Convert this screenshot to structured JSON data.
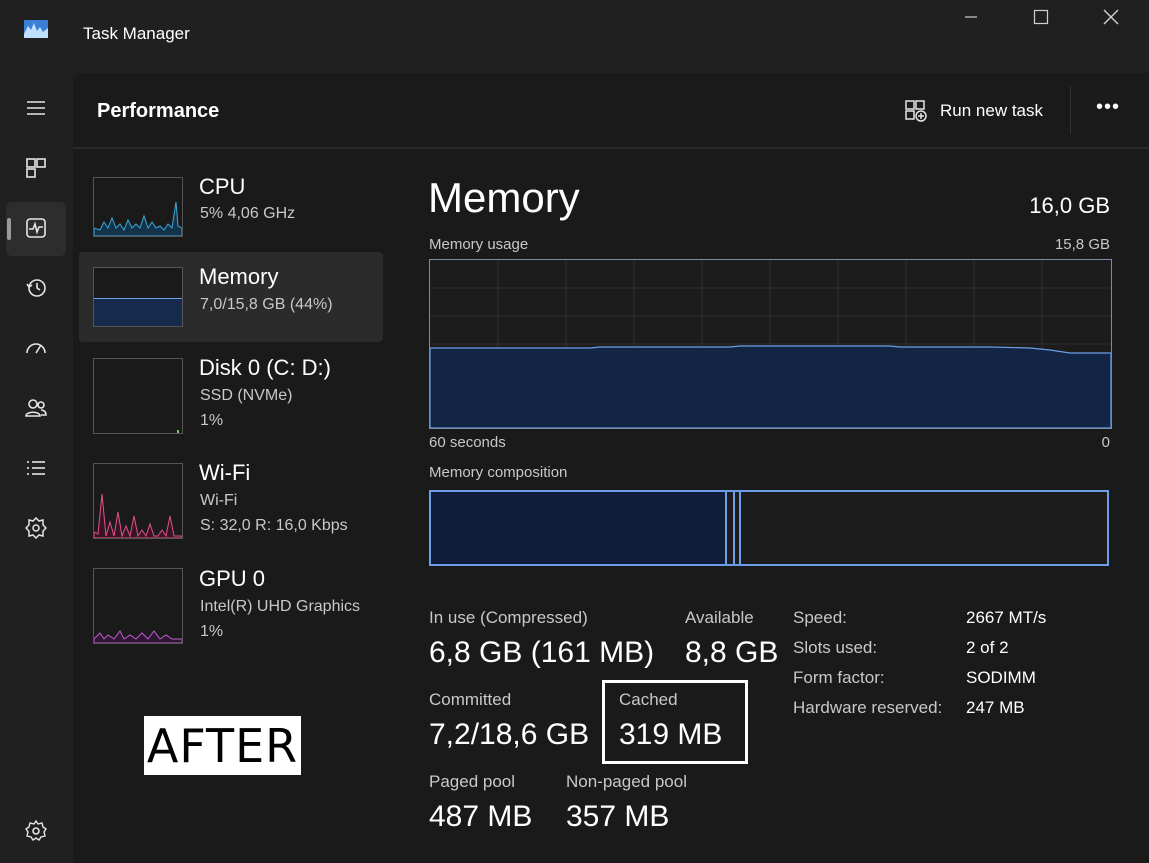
{
  "window": {
    "title": "Task Manager",
    "controls": [
      "minimize",
      "maximize",
      "close"
    ]
  },
  "nav": {
    "items": [
      {
        "icon": "hamburger-icon"
      },
      {
        "icon": "processes-icon"
      },
      {
        "icon": "performance-icon",
        "active": true
      },
      {
        "icon": "app-history-icon"
      },
      {
        "icon": "startup-apps-icon"
      },
      {
        "icon": "users-icon"
      },
      {
        "icon": "details-icon"
      },
      {
        "icon": "services-icon"
      },
      {
        "icon": "settings-icon"
      }
    ]
  },
  "header": {
    "title": "Performance",
    "run_new_task": "Run new task",
    "more": "•••"
  },
  "sidebar": {
    "cpu": {
      "name": "CPU",
      "line1": "5%  4,06 GHz",
      "color": "#3aa9d8"
    },
    "memory": {
      "name": "Memory",
      "line1": "7,0/15,8 GB (44%)",
      "color": "#6e9ee8",
      "active": true
    },
    "disk": {
      "name": "Disk 0 (C: D:)",
      "line1": "SSD (NVMe)",
      "line2": "1%",
      "color": "#7cc36a"
    },
    "wifi": {
      "name": "Wi-Fi",
      "line1": "Wi-Fi",
      "line2": "S: 32,0  R: 16,0 Kbps",
      "color": "#e0528a"
    },
    "gpu": {
      "name": "GPU 0",
      "line1": "Intel(R) UHD Graphics",
      "line2": "1%",
      "color": "#c05ccc"
    }
  },
  "memory": {
    "title": "Memory",
    "total": "16,0 GB",
    "usage_label": "Memory usage",
    "usage_max": "15,8 GB",
    "axis_left": "60 seconds",
    "axis_right": "0",
    "composition_label": "Memory composition",
    "stats": {
      "in_use_label": "In use (Compressed)",
      "in_use_value": "6,8 GB (161 MB)",
      "available_label": "Available",
      "available_value": "8,8 GB",
      "committed_label": "Committed",
      "committed_value": "7,2/18,6 GB",
      "cached_label": "Cached",
      "cached_value": "319 MB",
      "paged_label": "Paged pool",
      "paged_value": "487 MB",
      "nonpaged_label": "Non-paged pool",
      "nonpaged_value": "357 MB"
    },
    "specs": [
      {
        "label": "Speed:",
        "value": "2667 MT/s"
      },
      {
        "label": "Slots used:",
        "value": "2 of 2"
      },
      {
        "label": "Form factor:",
        "value": "SODIMM"
      },
      {
        "label": "Hardware reserved:",
        "value": "247 MB"
      }
    ]
  },
  "overlay_label": "AFTER"
}
